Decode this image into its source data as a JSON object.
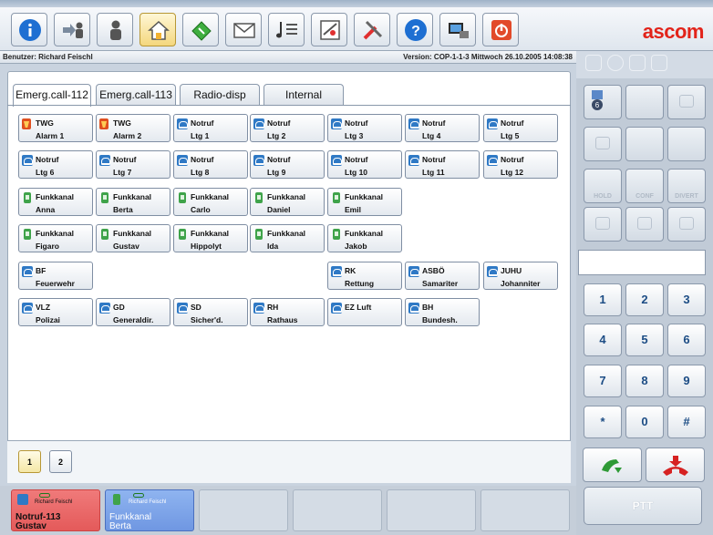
{
  "app": {
    "logo": "ascom"
  },
  "toolbar": {
    "buttons": [
      {
        "icon": "info-icon"
      },
      {
        "icon": "transfer-icon"
      },
      {
        "icon": "user-icon"
      },
      {
        "icon": "home-icon"
      },
      {
        "icon": "book-icon"
      },
      {
        "icon": "mail-icon"
      },
      {
        "icon": "music-list-icon"
      },
      {
        "icon": "settings-icon"
      },
      {
        "icon": "tools-icon"
      },
      {
        "icon": "help-icon"
      },
      {
        "icon": "monitor-icon"
      },
      {
        "icon": "power-icon"
      }
    ]
  },
  "infobar": {
    "user": "Benutzer: Richard Feischl",
    "version": "Version: COP-1-1-3  Mittwoch 26.10.2005 14:08:38"
  },
  "tabs": [
    "Emerg.call-112",
    "Emerg.call-113",
    "Radio-disp",
    "Internal"
  ],
  "keys": [
    {
      "icon": "alarm",
      "l1": "TWG",
      "l2": "Alarm 1"
    },
    {
      "icon": "alarm",
      "l1": "TWG",
      "l2": "Alarm 2"
    },
    {
      "icon": "phone",
      "l1": "Notruf",
      "l2": "Ltg 1"
    },
    {
      "icon": "phone",
      "l1": "Notruf",
      "l2": "Ltg 2"
    },
    {
      "icon": "phone",
      "l1": "Notruf",
      "l2": "Ltg 3"
    },
    {
      "icon": "phone",
      "l1": "Notruf",
      "l2": "Ltg 4"
    },
    {
      "icon": "phone",
      "l1": "Notruf",
      "l2": "Ltg 5"
    },
    {
      "icon": "phone",
      "l1": "Notruf",
      "l2": "Ltg 6"
    },
    {
      "icon": "phone",
      "l1": "Notruf",
      "l2": "Ltg 7"
    },
    {
      "icon": "phone",
      "l1": "Notruf",
      "l2": "Ltg 8"
    },
    {
      "icon": "phone",
      "l1": "Notruf",
      "l2": "Ltg 9"
    },
    {
      "icon": "phone",
      "l1": "Notruf",
      "l2": "Ltg 10"
    },
    {
      "icon": "phone",
      "l1": "Notruf",
      "l2": "Ltg 11"
    },
    {
      "icon": "phone",
      "l1": "Notruf",
      "l2": "Ltg 12"
    },
    {
      "icon": "radio",
      "l1": "Funkkanal",
      "l2": "Anna"
    },
    {
      "icon": "radio",
      "l1": "Funkkanal",
      "l2": "Berta"
    },
    {
      "icon": "radio",
      "l1": "Funkkanal",
      "l2": "Carlo"
    },
    {
      "icon": "radio",
      "l1": "Funkkanal",
      "l2": "Daniel"
    },
    {
      "icon": "radio",
      "l1": "Funkkanal",
      "l2": "Emil"
    },
    {
      "icon": "radio",
      "l1": "Funkkanal",
      "l2": "Figaro"
    },
    {
      "icon": "radio",
      "l1": "Funkkanal",
      "l2": "Gustav"
    },
    {
      "icon": "radio",
      "l1": "Funkkanal",
      "l2": "Hippolyt"
    },
    {
      "icon": "radio",
      "l1": "Funkkanal",
      "l2": "Ida"
    },
    {
      "icon": "radio",
      "l1": "Funkkanal",
      "l2": "Jakob"
    },
    {
      "icon": "phone",
      "l1": "BF",
      "l2": "Feuerwehr"
    },
    {
      "icon": "phone",
      "l1": "RK",
      "l2": "Rettung"
    },
    {
      "icon": "phone",
      "l1": "ASBÖ",
      "l2": "Samariter"
    },
    {
      "icon": "phone",
      "l1": "JUHU",
      "l2": "Johanniter"
    },
    {
      "icon": "phone",
      "l1": "VLZ",
      "l2": "Polizai"
    },
    {
      "icon": "phone",
      "l1": "GD",
      "l2": "Generaldir."
    },
    {
      "icon": "phone",
      "l1": "SD",
      "l2": "Sicher'd."
    },
    {
      "icon": "phone",
      "l1": "RH",
      "l2": "Rathaus"
    },
    {
      "icon": "phone",
      "l1": "EZ Luft",
      "l2": ""
    },
    {
      "icon": "phone",
      "l1": "BH",
      "l2": "Bundesh."
    }
  ],
  "pages": [
    "1",
    "2"
  ],
  "slots": [
    {
      "style": "red",
      "name": "Richard Feischl",
      "l1": "Notruf-113",
      "l2": "Gustav"
    },
    {
      "style": "blue",
      "name": "Richard Feischl",
      "l1": "Funkkanal",
      "l2": "Berta"
    },
    {
      "style": "empty",
      "name": "",
      "l1": "",
      "l2": ""
    },
    {
      "style": "empty",
      "name": "",
      "l1": "",
      "l2": ""
    },
    {
      "style": "empty",
      "name": "",
      "l1": "",
      "l2": ""
    },
    {
      "style": "empty",
      "name": "",
      "l1": "",
      "l2": ""
    }
  ],
  "side": {
    "badge": "6",
    "hold": "HOLD",
    "conf": "CONF",
    "divert": "DIVERT",
    "keypad": [
      "1",
      "2",
      "3",
      "4",
      "5",
      "6",
      "7",
      "8",
      "9",
      "*",
      "0",
      "#"
    ],
    "ptt": "PTT"
  }
}
